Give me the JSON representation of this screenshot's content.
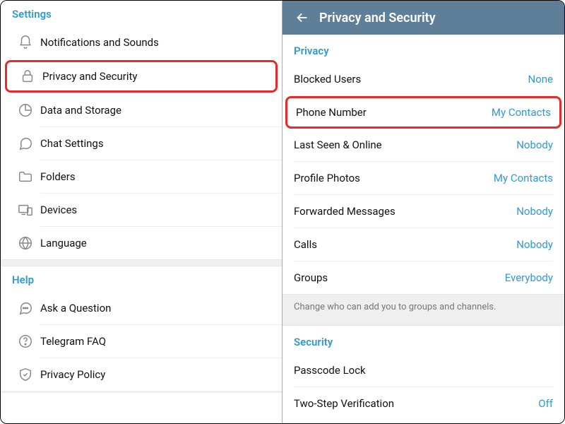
{
  "left": {
    "sections": {
      "settings_header": "Settings",
      "help_header": "Help"
    },
    "settings_items": [
      {
        "label": "Notifications and Sounds"
      },
      {
        "label": "Privacy and Security",
        "highlighted": true
      },
      {
        "label": "Data and Storage"
      },
      {
        "label": "Chat Settings"
      },
      {
        "label": "Folders"
      },
      {
        "label": "Devices"
      },
      {
        "label": "Language"
      }
    ],
    "help_items": [
      {
        "label": "Ask a Question"
      },
      {
        "label": "Telegram FAQ"
      },
      {
        "label": "Privacy Policy"
      }
    ]
  },
  "right": {
    "topbar_title": "Privacy and Security",
    "privacy_header": "Privacy",
    "privacy_items": [
      {
        "key": "Blocked Users",
        "value": "None"
      },
      {
        "key": "Phone Number",
        "value": "My Contacts",
        "highlighted": true
      },
      {
        "key": "Last Seen & Online",
        "value": "Nobody"
      },
      {
        "key": "Profile Photos",
        "value": "My Contacts"
      },
      {
        "key": "Forwarded Messages",
        "value": "Nobody"
      },
      {
        "key": "Calls",
        "value": "Nobody"
      },
      {
        "key": "Groups",
        "value": "Everybody"
      }
    ],
    "groups_note": "Change who can add you to groups and channels.",
    "security_header": "Security",
    "security_items": [
      {
        "key": "Passcode Lock",
        "value": ""
      },
      {
        "key": "Two-Step Verification",
        "value": "Off"
      }
    ]
  }
}
